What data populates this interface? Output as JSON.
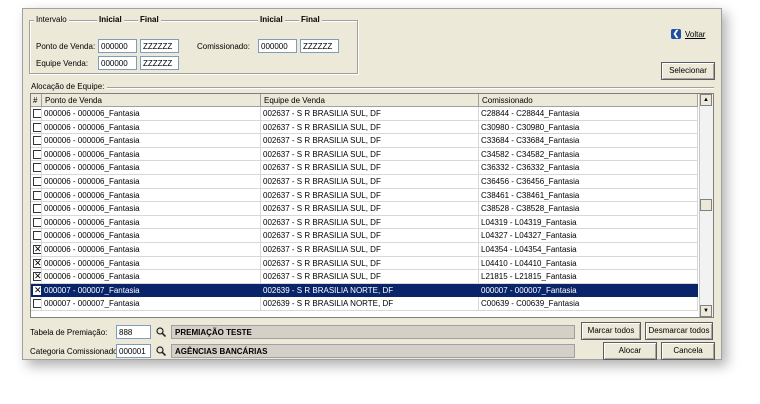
{
  "intervalo": {
    "title": "Intervalo",
    "col_inicial": "Inicial",
    "col_final": "Final",
    "ponto_venda_label": "Ponto de Venda:",
    "ponto_venda_inicial": "000000",
    "ponto_venda_final": "ZZZZZZ",
    "equipe_venda_label": "Equipe Venda:",
    "equipe_venda_inicial": "000000",
    "equipe_venda_final": "ZZZZZZ",
    "comissionado_label": "Comissionado:",
    "comissionado_inicial": "000000",
    "comissionado_final": "ZZZZZZ"
  },
  "toolbar": {
    "voltar_label": "Voltar",
    "voltar_icon": "back-arrow-icon",
    "selecionar_label": "Selecionar"
  },
  "alocacao": {
    "title": "Alocação de Equipe:",
    "headers": [
      "#",
      "Ponto de Venda",
      "Equipe de Venda",
      "Comissionado"
    ],
    "rows": [
      {
        "checked": false,
        "selected": false,
        "ponto": "000006 - 000006_Fantasia",
        "equipe": "002637 - S R BRASILIA SUL, DF",
        "comissionado": "C28844 - C28844_Fantasia"
      },
      {
        "checked": false,
        "selected": false,
        "ponto": "000006 - 000006_Fantasia",
        "equipe": "002637 - S R BRASILIA SUL, DF",
        "comissionado": "C30980 - C30980_Fantasia"
      },
      {
        "checked": false,
        "selected": false,
        "ponto": "000006 - 000006_Fantasia",
        "equipe": "002637 - S R BRASILIA SUL, DF",
        "comissionado": "C33684 - C33684_Fantasia"
      },
      {
        "checked": false,
        "selected": false,
        "ponto": "000006 - 000006_Fantasia",
        "equipe": "002637 - S R BRASILIA SUL, DF",
        "comissionado": "C34582 - C34582_Fantasia"
      },
      {
        "checked": false,
        "selected": false,
        "ponto": "000006 - 000006_Fantasia",
        "equipe": "002637 - S R BRASILIA SUL, DF",
        "comissionado": "C36332 - C36332_Fantasia"
      },
      {
        "checked": false,
        "selected": false,
        "ponto": "000006 - 000006_Fantasia",
        "equipe": "002637 - S R BRASILIA SUL, DF",
        "comissionado": "C36456 - C36456_Fantasia"
      },
      {
        "checked": false,
        "selected": false,
        "ponto": "000006 - 000006_Fantasia",
        "equipe": "002637 - S R BRASILIA SUL, DF",
        "comissionado": "C38461 - C38461_Fantasia"
      },
      {
        "checked": false,
        "selected": false,
        "ponto": "000006 - 000006_Fantasia",
        "equipe": "002637 - S R BRASILIA SUL, DF",
        "comissionado": "C38528 - C38528_Fantasia"
      },
      {
        "checked": false,
        "selected": false,
        "ponto": "000006 - 000006_Fantasia",
        "equipe": "002637 - S R BRASILIA SUL, DF",
        "comissionado": "L04319 - L04319_Fantasia"
      },
      {
        "checked": false,
        "selected": false,
        "ponto": "000006 - 000006_Fantasia",
        "equipe": "002637 - S R BRASILIA SUL, DF",
        "comissionado": "L04327 - L04327_Fantasia"
      },
      {
        "checked": true,
        "selected": false,
        "ponto": "000006 - 000006_Fantasia",
        "equipe": "002637 - S R BRASILIA SUL, DF",
        "comissionado": "L04354 - L04354_Fantasia"
      },
      {
        "checked": true,
        "selected": false,
        "ponto": "000006 - 000006_Fantasia",
        "equipe": "002637 - S R BRASILIA SUL, DF",
        "comissionado": "L04410 - L04410_Fantasia"
      },
      {
        "checked": true,
        "selected": false,
        "ponto": "000006 - 000006_Fantasia",
        "equipe": "002637 - S R BRASILIA SUL, DF",
        "comissionado": "L21815 - L21815_Fantasia"
      },
      {
        "checked": true,
        "selected": true,
        "ponto": "000007 - 000007_Fantasia",
        "equipe": "002639 - S R BRASILIA NORTE, DF",
        "comissionado": "000007 - 000007_Fantasia"
      },
      {
        "checked": false,
        "selected": false,
        "ponto": "000007 - 000007_Fantasia",
        "equipe": "002639 - S R BRASILIA NORTE, DF",
        "comissionado": "C00639 - C00639_Fantasia"
      }
    ]
  },
  "bottom": {
    "tabela_label": "Tabela de Premiação:",
    "tabela_value": "888",
    "tabela_desc": "PREMIAÇÃO TESTE",
    "categoria_label": "Categoria Comissionado:",
    "categoria_value": "000001",
    "categoria_desc": "AGÊNCIAS BANCÁRIAS",
    "search_icon": "search-icon",
    "marcar_label": "Marcar todos",
    "desmarcar_label": "Desmarcar todos",
    "alocar_label": "Alocar",
    "cancela_label": "Cancela"
  }
}
